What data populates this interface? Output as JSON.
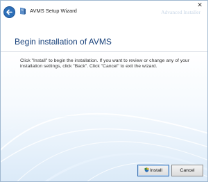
{
  "titlebar": {
    "title": "AVMS Setup Wizard",
    "watermark": "Advanced Installer",
    "close_glyph": "✕"
  },
  "header": {
    "heading": "Begin installation of AVMS"
  },
  "content": {
    "instructions": "Click \"Install\" to begin the installation.  If you want to review or change any of your installation settings, click \"Back\".  Click \"Cancel\" to exit the wizard."
  },
  "buttons": {
    "install_label": "Install",
    "cancel_label": "Cancel"
  },
  "colors": {
    "heading": "#17407a",
    "accent": "#2d6fb8"
  },
  "icons": {
    "back": "back-arrow-icon",
    "app": "setup-app-icon",
    "shield": "uac-shield-icon"
  }
}
